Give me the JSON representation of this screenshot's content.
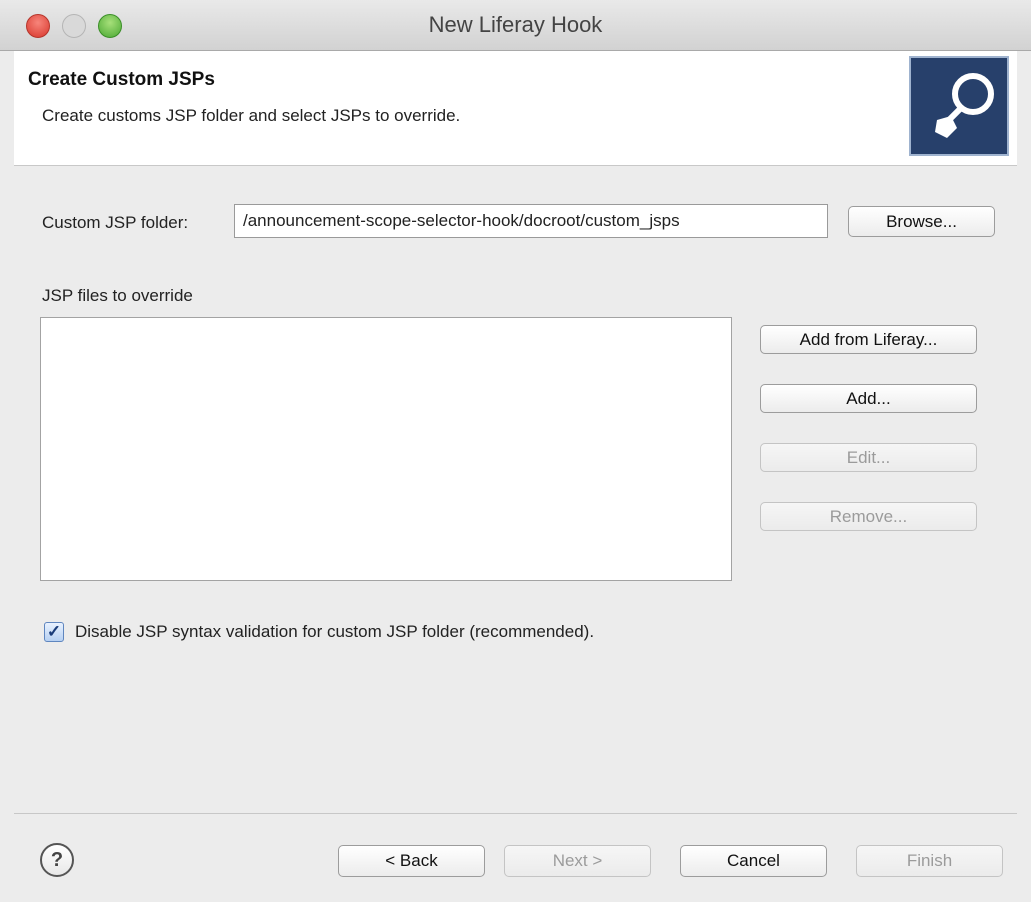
{
  "window": {
    "title": "New Liferay Hook"
  },
  "banner": {
    "title": "Create Custom JSPs",
    "description": "Create customs JSP folder and select JSPs to override.",
    "icon": "liferay-hook-wizard-icon"
  },
  "folder": {
    "label": "Custom JSP folder:",
    "value": "/announcement-scope-selector-hook/docroot/custom_jsps",
    "browse_label": "Browse..."
  },
  "jsp_files": {
    "label": "JSP files to override",
    "items": [],
    "buttons": {
      "add_from_liferay": "Add from Liferay...",
      "add": "Add...",
      "edit": "Edit...",
      "remove": "Remove..."
    }
  },
  "validation": {
    "label": "Disable JSP syntax validation for custom JSP folder (recommended).",
    "checked": true
  },
  "footer": {
    "help_icon": "help-icon",
    "back": "< Back",
    "next": "Next >",
    "cancel": "Cancel",
    "finish": "Finish"
  },
  "colors": {
    "banner_icon_bg": "#27406b",
    "close_button": "#e0443a",
    "maximize_button": "#5cb83d"
  }
}
